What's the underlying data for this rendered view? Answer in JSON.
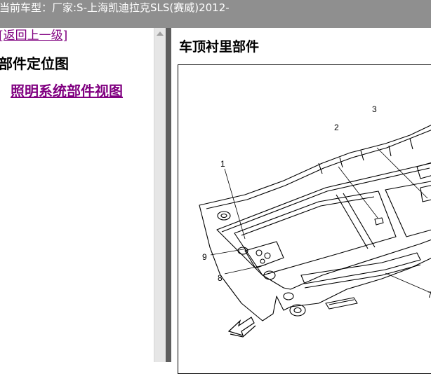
{
  "window": {
    "title": "当前车型：厂家:S-上海凯迪拉克SLS(赛威)2012-"
  },
  "sidebar": {
    "back_link": "[返回上一级]",
    "section_title": "部件定位图",
    "links": [
      "照明系统部件视图"
    ]
  },
  "main": {
    "part_title": "车顶衬里部件",
    "diagram_callouts": [
      "1",
      "2",
      "3",
      "7",
      "8",
      "9"
    ]
  },
  "colors": {
    "topbar": "#8f8f8f",
    "visited_link": "#800080",
    "divider": "#5e5e5e"
  }
}
